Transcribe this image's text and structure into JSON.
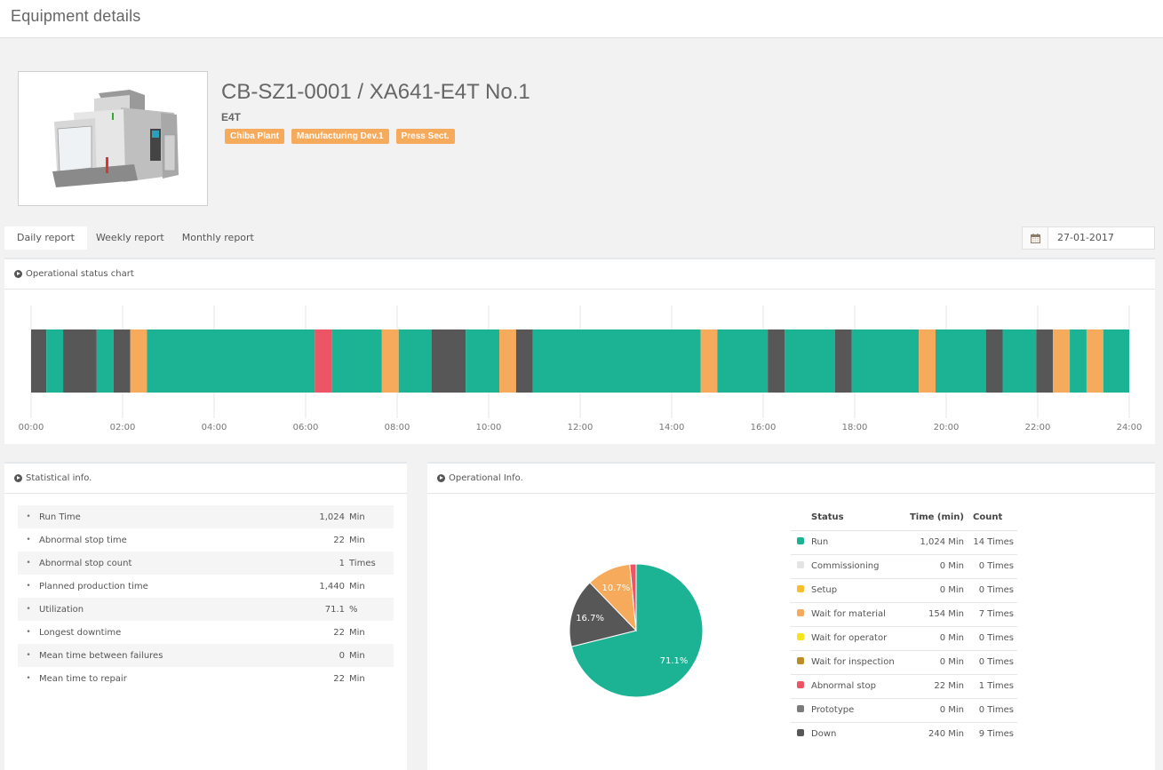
{
  "page": {
    "title": "Equipment details"
  },
  "equipment": {
    "name": "CB-SZ1-0001 / XA641-E4T No.1",
    "model": "E4T",
    "tags": [
      "Chiba Plant",
      "Manufacturing Dev.1",
      "Press Sect."
    ],
    "image_icon": "cnc-machine-illustration"
  },
  "report_tabs": [
    {
      "label": "Daily report",
      "active": true
    },
    {
      "label": "Weekly report",
      "active": false
    },
    {
      "label": "Monthly report",
      "active": false
    }
  ],
  "date_picker": {
    "icon": "calendar-icon",
    "value": "27-01-2017"
  },
  "colors": {
    "run": "#1bb394",
    "commissioning": "#e4e4e4",
    "setup": "#fbbf2e",
    "wait_material": "#f6aa5c",
    "wait_operator": "#f7e31e",
    "wait_inspection": "#c08a26",
    "abnormal": "#ec5565",
    "prototype": "#7b7b7b",
    "down": "#575757"
  },
  "operational_chart": {
    "title": "Operational status chart",
    "icon": "play-circle-icon"
  },
  "statistics": {
    "title": "Statistical info.",
    "icon": "play-circle-icon",
    "rows": [
      {
        "label": "Run Time",
        "value": "1,024",
        "unit": "Min"
      },
      {
        "label": "Abnormal stop time",
        "value": "22",
        "unit": "Min"
      },
      {
        "label": "Abnormal stop count",
        "value": "1",
        "unit": "Times"
      },
      {
        "label": "Planned production time",
        "value": "1,440",
        "unit": "Min"
      },
      {
        "label": "Utilization",
        "value": "71.1",
        "unit": "%"
      },
      {
        "label": "Longest downtime",
        "value": "22",
        "unit": "Min"
      },
      {
        "label": "Mean time between failures",
        "value": "0",
        "unit": "Min"
      },
      {
        "label": "Mean time to repair",
        "value": "22",
        "unit": "Min"
      }
    ]
  },
  "operational_info": {
    "title": "Operational Info.",
    "icon": "play-circle-icon",
    "table_headers": {
      "status": "Status",
      "time": "Time (min)",
      "count": "Count"
    },
    "rows": [
      {
        "status": "Run",
        "key": "run",
        "time": "1,024 Min",
        "count": "14 Times"
      },
      {
        "status": "Commissioning",
        "key": "commissioning",
        "time": "0 Min",
        "count": "0 Times"
      },
      {
        "status": "Setup",
        "key": "setup",
        "time": "0 Min",
        "count": "0 Times"
      },
      {
        "status": "Wait for material",
        "key": "wait_material",
        "time": "154 Min",
        "count": "7 Times"
      },
      {
        "status": "Wait for operator",
        "key": "wait_operator",
        "time": "0 Min",
        "count": "0 Times"
      },
      {
        "status": "Wait for inspection",
        "key": "wait_inspection",
        "time": "0 Min",
        "count": "0 Times"
      },
      {
        "status": "Abnormal stop",
        "key": "abnormal",
        "time": "22 Min",
        "count": "1 Times"
      },
      {
        "status": "Prototype",
        "key": "prototype",
        "time": "0 Min",
        "count": "0 Times"
      },
      {
        "status": "Down",
        "key": "down",
        "time": "240 Min",
        "count": "9 Times"
      }
    ]
  },
  "chart_data": [
    {
      "type": "timeline",
      "title": "Operational status chart",
      "x_unit": "minutes since 00:00",
      "xlim": [
        0,
        1440
      ],
      "tick_labels": [
        "00:00",
        "02:00",
        "04:00",
        "06:00",
        "08:00",
        "10:00",
        "12:00",
        "14:00",
        "16:00",
        "18:00",
        "20:00",
        "22:00",
        "24:00"
      ],
      "grid": true,
      "segments": [
        {
          "start": 0,
          "end": 20,
          "status": "down"
        },
        {
          "start": 20,
          "end": 42,
          "status": "run"
        },
        {
          "start": 42,
          "end": 86,
          "status": "down"
        },
        {
          "start": 86,
          "end": 108,
          "status": "run"
        },
        {
          "start": 108,
          "end": 130,
          "status": "down"
        },
        {
          "start": 130,
          "end": 152,
          "status": "wait_material"
        },
        {
          "start": 152,
          "end": 372,
          "status": "run"
        },
        {
          "start": 372,
          "end": 394,
          "status": "abnormal"
        },
        {
          "start": 394,
          "end": 460,
          "status": "run"
        },
        {
          "start": 460,
          "end": 482,
          "status": "wait_material"
        },
        {
          "start": 482,
          "end": 525,
          "status": "run"
        },
        {
          "start": 525,
          "end": 570,
          "status": "down"
        },
        {
          "start": 570,
          "end": 614,
          "status": "run"
        },
        {
          "start": 614,
          "end": 636,
          "status": "wait_material"
        },
        {
          "start": 636,
          "end": 658,
          "status": "down"
        },
        {
          "start": 658,
          "end": 878,
          "status": "run"
        },
        {
          "start": 878,
          "end": 900,
          "status": "wait_material"
        },
        {
          "start": 900,
          "end": 966,
          "status": "run"
        },
        {
          "start": 966,
          "end": 988,
          "status": "down"
        },
        {
          "start": 988,
          "end": 1054,
          "status": "run"
        },
        {
          "start": 1054,
          "end": 1076,
          "status": "down"
        },
        {
          "start": 1076,
          "end": 1164,
          "status": "run"
        },
        {
          "start": 1164,
          "end": 1186,
          "status": "wait_material"
        },
        {
          "start": 1186,
          "end": 1252,
          "status": "run"
        },
        {
          "start": 1252,
          "end": 1274,
          "status": "down"
        },
        {
          "start": 1274,
          "end": 1318,
          "status": "run"
        },
        {
          "start": 1318,
          "end": 1340,
          "status": "down"
        },
        {
          "start": 1340,
          "end": 1362,
          "status": "wait_material"
        },
        {
          "start": 1362,
          "end": 1384,
          "status": "run"
        },
        {
          "start": 1384,
          "end": 1406,
          "status": "wait_material"
        },
        {
          "start": 1406,
          "end": 1440,
          "status": "run"
        }
      ]
    },
    {
      "type": "pie",
      "title": "Operational Info.",
      "slices": [
        {
          "label": "Run",
          "key": "run",
          "value": 1024,
          "display": "71.1%"
        },
        {
          "label": "Down",
          "key": "down",
          "value": 240,
          "display": "16.7%"
        },
        {
          "label": "Wait for material",
          "key": "wait_material",
          "value": 154,
          "display": "10.7%"
        },
        {
          "label": "Abnormal stop",
          "key": "abnormal",
          "value": 22,
          "display": ""
        }
      ],
      "start_angle": "12 o'clock, clockwise"
    }
  ]
}
